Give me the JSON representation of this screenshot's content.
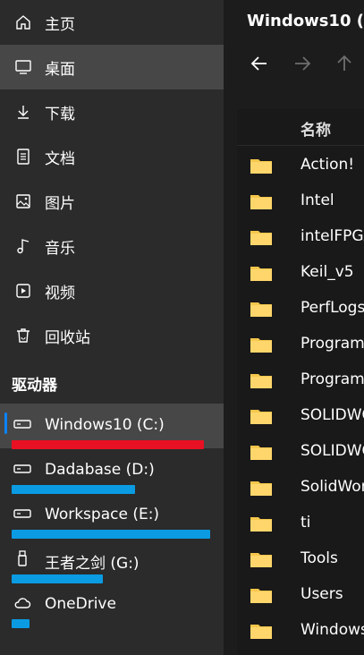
{
  "window": {
    "title": "Windows10 (C:"
  },
  "navigation": [
    {
      "label": "主页",
      "icon": "home-icon"
    },
    {
      "label": "桌面",
      "icon": "desktop-icon",
      "selected": true
    },
    {
      "label": "下载",
      "icon": "download-icon"
    },
    {
      "label": "文档",
      "icon": "document-icon"
    },
    {
      "label": "图片",
      "icon": "picture-icon"
    },
    {
      "label": "音乐",
      "icon": "music-icon"
    },
    {
      "label": "视频",
      "icon": "video-icon"
    },
    {
      "label": "回收站",
      "icon": "recycle-bin-icon"
    }
  ],
  "drives_section": {
    "title": "驱动器"
  },
  "drives": [
    {
      "label": "Windows10 (C:)",
      "icon": "hard-drive-icon",
      "selected": true,
      "usage_fraction": 0.97,
      "usage_color": "#e81123"
    },
    {
      "label": "Dadabase (D:)",
      "icon": "hard-drive-icon",
      "usage_fraction": 0.62,
      "usage_color": "#0a9be3"
    },
    {
      "label": "Workspace (E:)",
      "icon": "hard-drive-icon",
      "usage_fraction": 1.0,
      "usage_color": "#0a9be3"
    },
    {
      "label": "王者之剑 (G:)",
      "icon": "usb-drive-icon",
      "usage_fraction": 0.46,
      "usage_color": "#0a9be3"
    },
    {
      "label": "OneDrive",
      "icon": "cloud-icon",
      "usage_fraction": 0.09,
      "usage_color": "#0a9be3"
    }
  ],
  "file_list": {
    "column_header": "名称",
    "items": [
      "Action!",
      "Intel",
      "intelFPGA",
      "Keil_v5",
      "PerfLogs",
      "Program",
      "Program",
      "SOLIDWO",
      "SOLIDWO",
      "SolidWor",
      "ti",
      "Tools",
      "Users",
      "Windows"
    ]
  },
  "colors": {
    "sidebar_bg": "#2b2b2b",
    "selected_bg": "#474747",
    "main_bg": "#1c1c1c",
    "folder": "#f4c64c"
  }
}
